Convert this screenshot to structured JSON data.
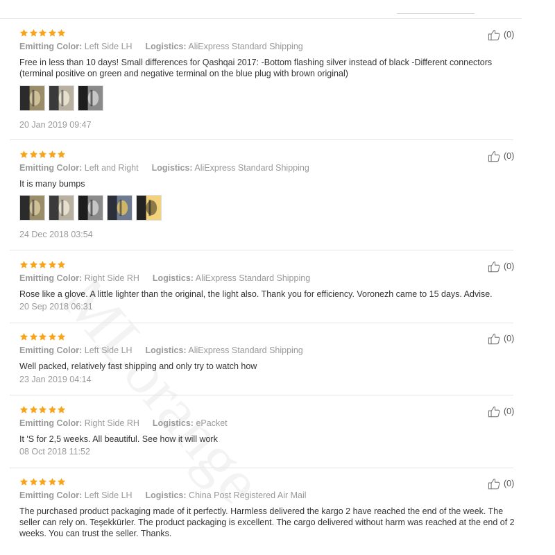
{
  "accent_star_color": "#f7a41c",
  "labels": {
    "color": "Emitting Color:",
    "logistics": "Logistics:"
  },
  "watermark": "MLorange",
  "reviews": [
    {
      "color": "Left Side LH",
      "logistics": "AliExpress Standard Shipping",
      "text": "Free in less than 10 days! Small differences for Qashqai 2017: -Bottom flashing silver instead of black -Different connectors (terminal positive on green and negative terminal on the blue plug with brown original)",
      "date": "20 Jan 2019 09:47",
      "helpful": "(0)",
      "photos": [
        "photo-1",
        "photo-2",
        "photo-3"
      ]
    },
    {
      "color": "Left and Right",
      "logistics": "AliExpress Standard Shipping",
      "text": "It is many bumps",
      "date": "24 Dec 2018 03:54",
      "helpful": "(0)",
      "photos": [
        "photo-1",
        "photo-2",
        "photo-3",
        "photo-4",
        "photo-5"
      ]
    },
    {
      "color": "Right Side RH",
      "logistics": "AliExpress Standard Shipping",
      "text": "Rose like a glove. A little lighter than the original, the light also. Thank you for efficiency. Voronezh came to 15 days. Advise.",
      "date": "20 Sep 2018 06:31",
      "helpful": "(0)",
      "photos": []
    },
    {
      "color": "Left Side LH",
      "logistics": "AliExpress Standard Shipping",
      "text": "Well packed, relatively fast shipping and only try to watch how",
      "date": "23 Jan 2019 04:14",
      "helpful": "(0)",
      "photos": []
    },
    {
      "color": "Right Side RH",
      "logistics": "ePacket",
      "text": "It 'S for 2,5 weeks. All beautiful. See how it will work",
      "date": "08 Oct 2018 11:52",
      "helpful": "(0)",
      "photos": []
    },
    {
      "color": "Left Side LH",
      "logistics": "China Post Registered Air Mail",
      "text": "The purchased product packaging made of it perfectly. Harmless delivered the kargo 2 have reached the end of the week. The seller can rely on. Teşekkürler. The product packaging is excellent. The cargo delivered without harm was reached at the end of 2 weeks. You can trust the seller. Thanks.",
      "date": "",
      "helpful": "(0)",
      "photos": []
    }
  ]
}
